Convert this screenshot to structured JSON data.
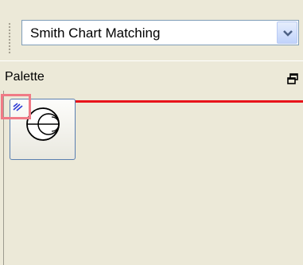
{
  "toolbar": {
    "combo_value": "Smith Chart Matching"
  },
  "palette": {
    "title": "Palette"
  },
  "icons": {
    "dropdown": "chevron-down-icon",
    "restore": "restore-window-icon",
    "item": "smith-chart-icon",
    "expand": "double-chevron-icon"
  },
  "colors": {
    "accent_red": "#e8141b",
    "highlight": "#f07a86",
    "panel_bg": "#ece9d8",
    "border_blue": "#5a7fb0"
  }
}
